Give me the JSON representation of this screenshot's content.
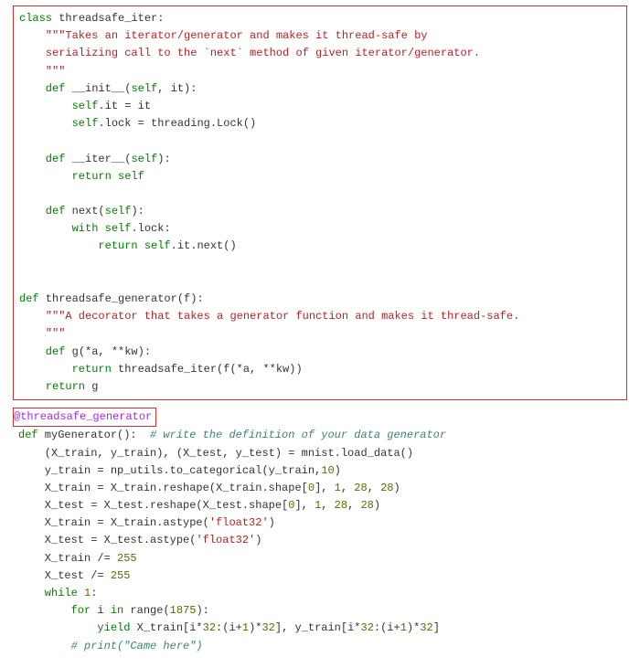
{
  "block1": {
    "l1_kw": "class",
    "l1_name": " threadsafe_iter:",
    "l2_doc": "    \"\"\"Takes an iterator/generator and makes it thread-safe by",
    "l3_doc": "    serializing call to the `next` method of given iterator/generator.",
    "l4_doc": "    \"\"\"",
    "l5_kw": "    def",
    "l5_sig": " __init__(",
    "l5_self": "self",
    "l5_rest": ", it):",
    "l6_self": "        self",
    "l6_rest": ".it = it",
    "l7_self": "        self",
    "l7_rest": ".lock = threading.Lock()",
    "l8_blank": " ",
    "l9_kw": "    def",
    "l9_sig": " __iter__(",
    "l9_self": "self",
    "l9_rest": "):",
    "l10_kw": "        return",
    "l10_self": " self",
    "l11_blank": " ",
    "l12_kw": "    def",
    "l12_sig": " next(",
    "l12_self": "self",
    "l12_rest": "):",
    "l13_kw": "        with",
    "l13_self": " self",
    "l13_rest": ".lock:",
    "l14_kw": "            return",
    "l14_self": " self",
    "l14_rest": ".it.next()",
    "l15_blank": " ",
    "l16_blank": " ",
    "l17_kw": "def",
    "l17_rest": " threadsafe_generator(f):",
    "l18_doc": "    \"\"\"A decorator that takes a generator function and makes it thread-safe.",
    "l19_doc": "    \"\"\"",
    "l20_kw": "    def",
    "l20_rest": " g(*a, **kw):",
    "l21_kw": "        return",
    "l21_rest": " threadsafe_iter(f(*a, **kw))",
    "l22_kw": "    return",
    "l22_rest": " g"
  },
  "decorator": {
    "text": "@threadsafe_generator"
  },
  "block3": {
    "l1_kw": "def",
    "l1_rest": " myGenerator():  ",
    "l1_cmt": "# write the definition of your data generator",
    "l2": "    (X_train, y_train), (X_test, y_test) = mnist.load_data()",
    "l3a": "    y_train = np_utils.to_categorical(y_train,",
    "l3n": "10",
    "l3b": ")",
    "l4a": "    X_train = X_train.reshape(X_train.shape[",
    "l4n0": "0",
    "l4b": "], ",
    "l4n1": "1",
    "l4c": ", ",
    "l4n2": "28",
    "l4d": ", ",
    "l4n3": "28",
    "l4e": ")",
    "l5a": "    X_test = X_test.reshape(X_test.shape[",
    "l5n0": "0",
    "l5b": "], ",
    "l5n1": "1",
    "l5c": ", ",
    "l5n2": "28",
    "l5d": ", ",
    "l5n3": "28",
    "l5e": ")",
    "l6a": "    X_train = X_train.astype(",
    "l6s": "'float32'",
    "l6b": ")",
    "l7a": "    X_test = X_test.astype(",
    "l7s": "'float32'",
    "l7b": ")",
    "l8a": "    X_train /= ",
    "l8n": "255",
    "l9a": "    X_test /= ",
    "l9n": "255",
    "l10_kw": "    while",
    "l10_rest": " ",
    "l10_n": "1",
    "l10_col": ":",
    "l11_kw": "        for",
    "l11_mid": " i ",
    "l11_in": "in",
    "l11_rest": " range(",
    "l11_n": "1875",
    "l11_end": "):",
    "l12_kw": "            yield",
    "l12a": " X_train[i*",
    "l12n1": "32",
    "l12b": ":(i+",
    "l12n2": "1",
    "l12c": ")*",
    "l12n3": "32",
    "l12d": "], y_train[i*",
    "l12n4": "32",
    "l12e": ":(i+",
    "l12n5": "1",
    "l12f": ")*",
    "l12n6": "32",
    "l12g": "]",
    "l13_cmt": "        # print(\"Came here\")"
  }
}
